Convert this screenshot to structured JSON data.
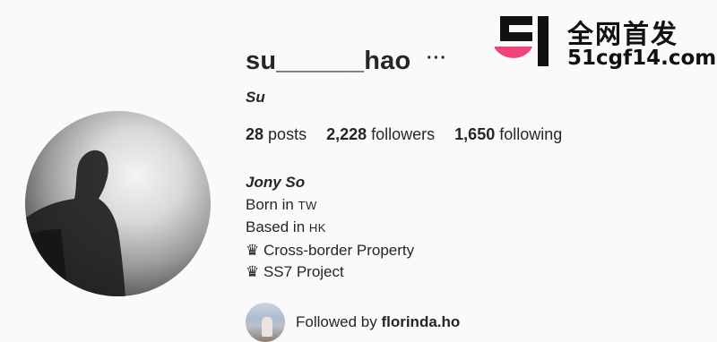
{
  "profile": {
    "username": "su______hao",
    "more_icon": "ellipsis-icon",
    "full_name": "Su",
    "stats": {
      "posts_count": "28",
      "posts_label": "posts",
      "followers_count": "2,228",
      "followers_label": "followers",
      "following_count": "1,650",
      "following_label": "following"
    },
    "bio": {
      "name": "Jony So",
      "line1_prefix": "Born in",
      "line1_code": "TW",
      "line2_prefix": "Based in",
      "line2_code": "HK",
      "line3": "♛ Cross-border Property",
      "line4": "♛ SS7 Project"
    },
    "followed_by": {
      "prefix": "Followed by",
      "account": "florinda.ho"
    }
  },
  "watermark": {
    "title": "全网首发",
    "domain": "51cgf14.com",
    "accent_color": "#f0437a"
  }
}
